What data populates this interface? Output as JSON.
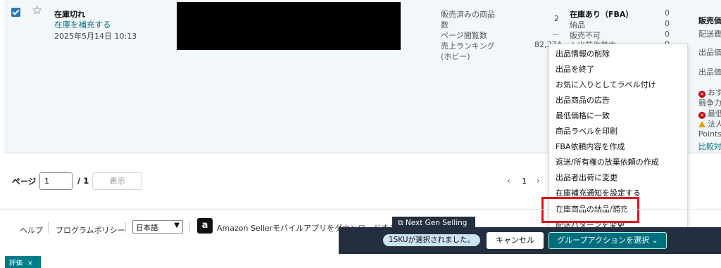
{
  "row": {
    "status_title": "在庫切れ",
    "restock_link": "在庫を補充する",
    "date": "2025年5月14日 10:13",
    "metrics": [
      {
        "label": "販売済みの商品",
        "value": "2"
      },
      {
        "label": "数",
        "value": ""
      },
      {
        "label": "ページ閲覧数",
        "value": "--"
      },
      {
        "label": "売上ランキング",
        "value": "82,374"
      },
      {
        "label": "(ホビー)",
        "value": ""
      }
    ],
    "inventory": [
      {
        "label": "在庫あり（FBA）",
        "value": "0"
      },
      {
        "label": "納品",
        "value": "0"
      },
      {
        "label": "販売不可",
        "value": "0"
      },
      {
        "label": "入出荷作業中",
        "value": "0"
      }
    ],
    "right_col": {
      "sales_price": "販売価",
      "shipping": "配送費",
      "price1": "出品価",
      "price2": "出品価",
      "err1": "おす",
      "competitive": "競争力",
      "err2": "最低",
      "warn": "法人",
      "points": "Points",
      "compare": "比較対"
    }
  },
  "menu": {
    "items": [
      "出品情報の削除",
      "出品を終了",
      "お気に入りとしてラベル付け",
      "出品商品の広告",
      "最低価格に一致",
      "商品ラベルを印刷",
      "FBA依頼内容を作成",
      "返送/所有権の放棄依頼の作成",
      "出品者出荷に変更",
      "在庫補充通知を設定する",
      "在庫商品の納品/補充",
      "配送パターンを変更"
    ]
  },
  "pager": {
    "label": "ページ",
    "current": "1",
    "total": "/ 1",
    "show_button": "表示",
    "page_number": "1"
  },
  "footer": {
    "help": "ヘルプ",
    "policy": "プログラムポリシー",
    "language": "日本語",
    "app_text": "Amazon Sellerモバイルアプリをダウンロードする",
    "next_gen": "Next Gen Selling"
  },
  "action_bar": {
    "selected": "1SKUが選択されました。",
    "cancel": "キャンセル",
    "group_action": "グループアクションを選択"
  },
  "tag": {
    "label": "評価"
  }
}
